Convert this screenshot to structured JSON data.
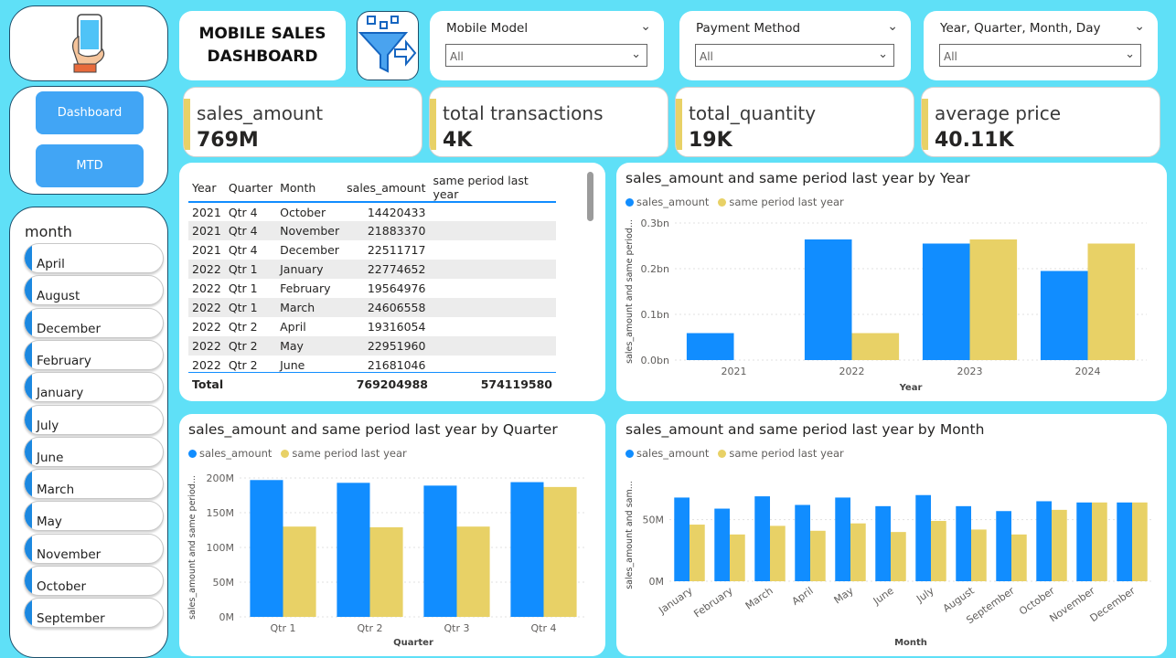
{
  "header": {
    "title_line1": "MOBILE SALES",
    "title_line2": "DASHBOARD"
  },
  "slicers": [
    {
      "label": "Mobile Model",
      "value": "All"
    },
    {
      "label": "Payment Method",
      "value": "All"
    },
    {
      "label": "Year, Quarter, Month, Day",
      "value": "All"
    }
  ],
  "kpis": [
    {
      "label": "sales_amount",
      "value": "769M"
    },
    {
      "label": "total transactions",
      "value": "4K"
    },
    {
      "label": "total_quantity",
      "value": "19K"
    },
    {
      "label": "average price",
      "value": "40.11K"
    }
  ],
  "nav": {
    "dashboard": "Dashboard",
    "mtd": "MTD"
  },
  "month_slicer": {
    "title": "month",
    "items": [
      "April",
      "August",
      "December",
      "February",
      "January",
      "July",
      "June",
      "March",
      "May",
      "November",
      "October",
      "September"
    ]
  },
  "table": {
    "headers": [
      "Year",
      "Quarter",
      "Month",
      "sales_amount",
      "same period last year"
    ],
    "rows": [
      [
        "2021",
        "Qtr 4",
        "October",
        "14420433",
        ""
      ],
      [
        "2021",
        "Qtr 4",
        "November",
        "21883370",
        ""
      ],
      [
        "2021",
        "Qtr 4",
        "December",
        "22511717",
        ""
      ],
      [
        "2022",
        "Qtr 1",
        "January",
        "22774652",
        ""
      ],
      [
        "2022",
        "Qtr 1",
        "February",
        "19564976",
        ""
      ],
      [
        "2022",
        "Qtr 1",
        "March",
        "24606558",
        ""
      ],
      [
        "2022",
        "Qtr 2",
        "April",
        "19316054",
        ""
      ],
      [
        "2022",
        "Qtr 2",
        "May",
        "22951960",
        ""
      ],
      [
        "2022",
        "Qtr 2",
        "June",
        "21681046",
        ""
      ]
    ],
    "total": {
      "label": "Total",
      "sales_amount": "769204988",
      "same_period": "574119580"
    }
  },
  "colors": {
    "sales": "#118dff",
    "same_period": "#e8d166",
    "background": "#5fe0f7"
  },
  "chart_data": [
    {
      "type": "bar",
      "title": "sales_amount and same period last year by Year",
      "xlabel": "Year",
      "ylabel": "sales_amount and same period...",
      "categories": [
        "2021",
        "2022",
        "2023",
        "2024"
      ],
      "series": [
        {
          "name": "sales_amount",
          "values": [
            0.059,
            0.264,
            0.255,
            0.195
          ]
        },
        {
          "name": "same period last year",
          "values": [
            0,
            0.059,
            0.264,
            0.255
          ]
        }
      ],
      "yticks": [
        "0.0bn",
        "0.1bn",
        "0.2bn",
        "0.3bn"
      ],
      "ylim": [
        0,
        0.3
      ],
      "legend_position": "top-left"
    },
    {
      "type": "bar",
      "title": "sales_amount and same period last year by Quarter",
      "xlabel": "Quarter",
      "ylabel": "sales_amount and same period...",
      "categories": [
        "Qtr 1",
        "Qtr 2",
        "Qtr 3",
        "Qtr 4"
      ],
      "series": [
        {
          "name": "sales_amount",
          "values": [
            197,
            193,
            189,
            194
          ]
        },
        {
          "name": "same period last year",
          "values": [
            130,
            129,
            130,
            187
          ]
        }
      ],
      "yticks": [
        "0M",
        "50M",
        "100M",
        "150M",
        "200M"
      ],
      "ylim": [
        0,
        200
      ],
      "legend_position": "top-left"
    },
    {
      "type": "bar",
      "title": "sales_amount and same period last year by Month",
      "xlabel": "Month",
      "ylabel": "sales_amount and sam...",
      "categories": [
        "January",
        "February",
        "March",
        "April",
        "May",
        "June",
        "July",
        "August",
        "September",
        "October",
        "November",
        "December"
      ],
      "series": [
        {
          "name": "sales_amount",
          "values": [
            68,
            59,
            69,
            62,
            68,
            61,
            70,
            61,
            57,
            65,
            64,
            64
          ]
        },
        {
          "name": "same period last year",
          "values": [
            46,
            38,
            45,
            41,
            47,
            40,
            49,
            42,
            38,
            58,
            64,
            64
          ]
        }
      ],
      "yticks": [
        "0M",
        "50M"
      ],
      "ylim": [
        0,
        75
      ],
      "legend_position": "top-left"
    }
  ]
}
